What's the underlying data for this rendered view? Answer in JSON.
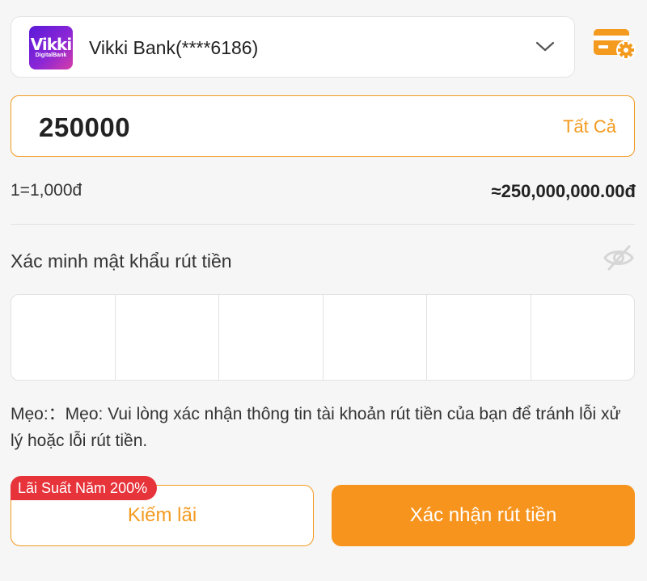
{
  "account": {
    "logo_text": "Vikki",
    "logo_subtext": "DigitalBank",
    "bank_label": "Vikki Bank(****6186)"
  },
  "amount": {
    "value": "250000",
    "all_label": "Tất Cả"
  },
  "rate": {
    "exchange": "1=1,000đ",
    "converted": "≈250,000,000.00đ"
  },
  "password": {
    "label": "Xác minh mật khẩu rút tiền",
    "digits": [
      "",
      "",
      "",
      "",
      "",
      ""
    ]
  },
  "tip": {
    "text": "Mẹo:：Mẹo: Vui lòng xác nhận thông tin tài khoản rút tiền của bạn để tránh lỗi xử lý hoặc lỗi rút tiền."
  },
  "actions": {
    "badge": "Lãi Suất Năm 200%",
    "earn_label": "Kiếm lãi",
    "confirm_label": "Xác nhận rút tiền"
  },
  "colors": {
    "accent": "#f39a1f",
    "primary_button": "#f7941d",
    "badge": "#e7333a"
  },
  "icons": [
    "chevron-down-icon",
    "card-settings-icon",
    "eye-hidden-icon"
  ]
}
